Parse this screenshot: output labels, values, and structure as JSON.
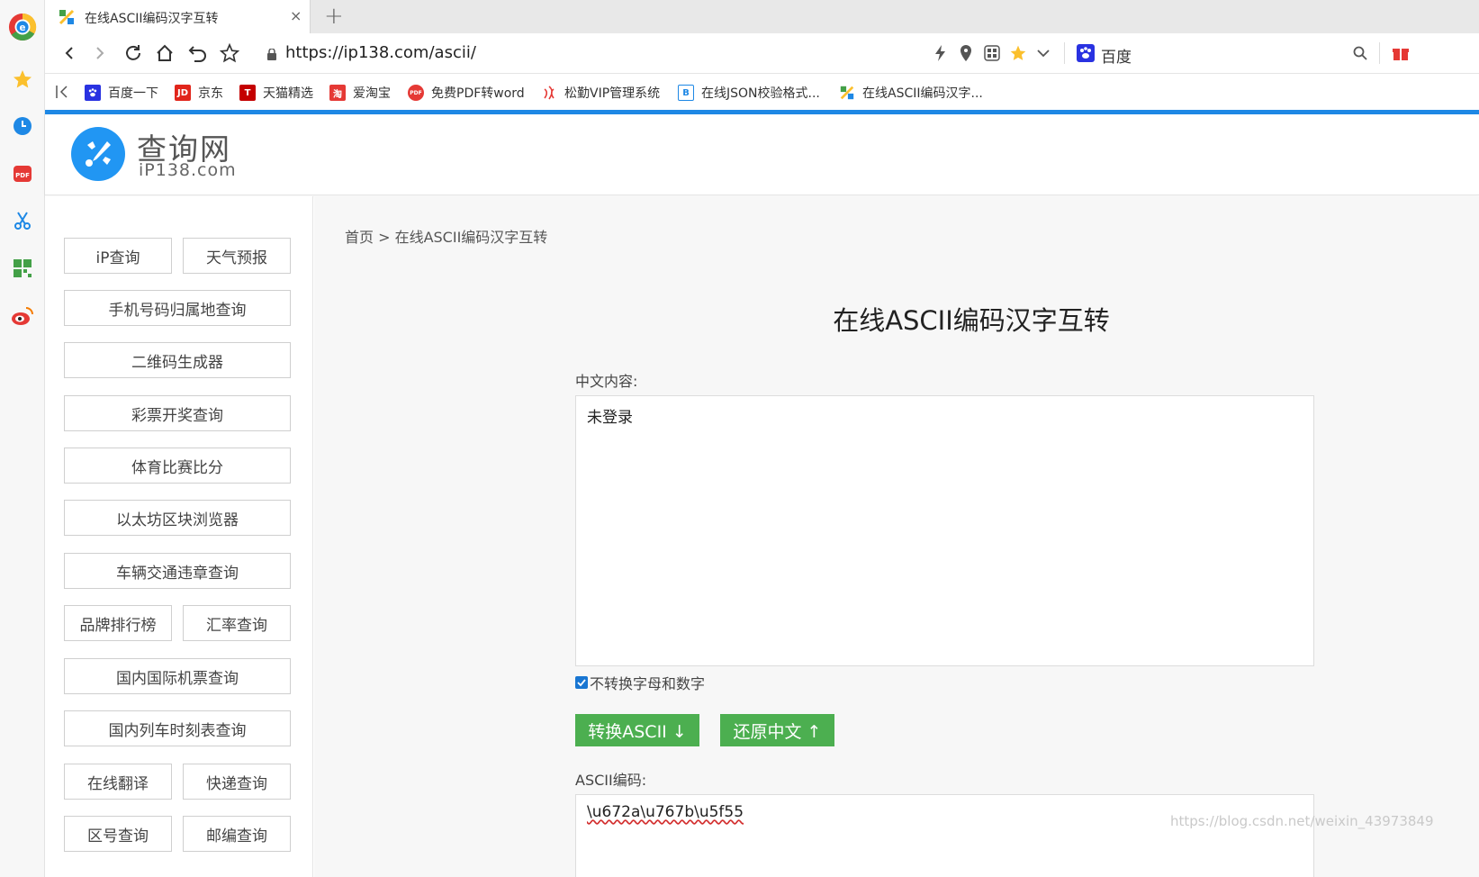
{
  "browser": {
    "tab": {
      "title": "在线ASCII编码汉字互转",
      "close": "×"
    },
    "new_tab": "+",
    "url": "https://ip138.com/ascii/",
    "search_engine": "百度",
    "bookmarks": [
      {
        "label": "百度一下",
        "icon": "baidu-paw-icon",
        "color": "#2932e1"
      },
      {
        "label": "京东",
        "icon": "jd-icon",
        "color": "#e1251b"
      },
      {
        "label": "天猫精选",
        "icon": "tmall-icon",
        "color": "#c40000"
      },
      {
        "label": "爱淘宝",
        "icon": "taobao-icon",
        "color": "#e53935"
      },
      {
        "label": "免费PDF转word",
        "icon": "pdf-icon",
        "color": "#e53935"
      },
      {
        "label": "松勤VIP管理系统",
        "icon": "songqin-icon",
        "color": "#e53935"
      },
      {
        "label": "在线JSON校验格式...",
        "icon": "json-icon",
        "color": "#1e88e5"
      },
      {
        "label": "在线ASCII编码汉字...",
        "icon": "ip138-icon",
        "color": "#43a047"
      }
    ],
    "bookmark_icon_text": {
      "jd": "JD",
      "tmall": "T",
      "taobao": "淘",
      "pdf": "PDF",
      "json": "B"
    }
  },
  "sidebar_icons": [
    "browser-logo-icon",
    "star-icon",
    "clock-icon",
    "pdf-icon",
    "scissors-icon",
    "qrcode-icon",
    "weibo-icon"
  ],
  "sidebar_pdf_text": "PDF",
  "site": {
    "logo_cn": "查询网",
    "logo_en": "iP138.com"
  },
  "nav": [
    "iP查询",
    "天气预报",
    "手机号码归属地查询",
    "二维码生成器",
    "彩票开奖查询",
    "体育比赛比分",
    "以太坊区块浏览器",
    "车辆交通违章查询",
    "品牌排行榜",
    "汇率查询",
    "国内国际机票查询",
    "国内列车时刻表查询",
    "在线翻译",
    "快递查询",
    "区号查询",
    "邮编查询"
  ],
  "main": {
    "breadcrumb": "首页 > 在线ASCII编码汉字互转",
    "title": "在线ASCII编码汉字互转",
    "chinese_label": "中文内容:",
    "chinese_value": "未登录",
    "checkbox_label": "不转换字母和数字",
    "checkbox_checked": true,
    "convert_button": "转换ASCII ↓",
    "restore_button": "还原中文 ↑",
    "ascii_label": "ASCII编码:",
    "ascii_value": "\\u672a\\u767b\\u5f55"
  },
  "watermark": "https://blog.csdn.net/weixin_43973849",
  "colors": {
    "accent_blue": "#1e88e5",
    "button_green": "#4caf50"
  }
}
